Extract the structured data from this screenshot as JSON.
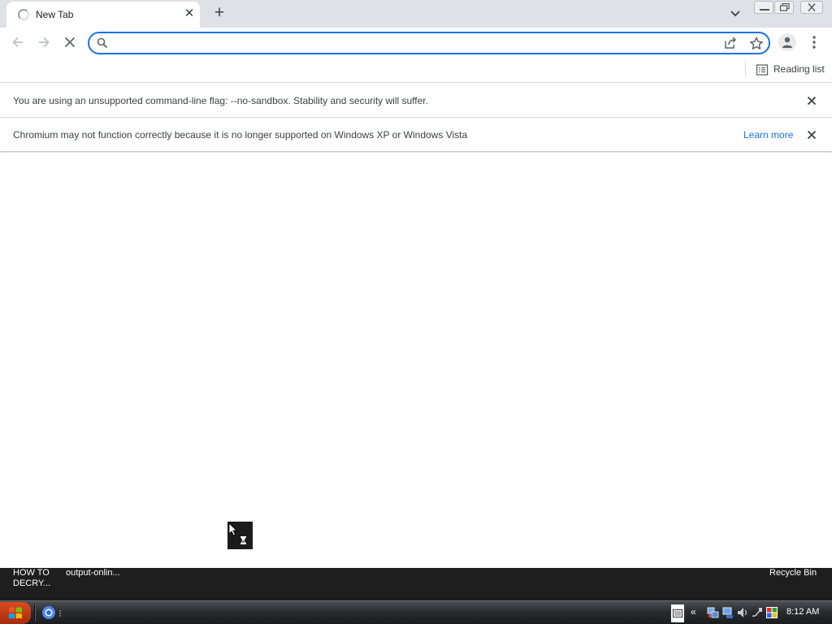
{
  "browser": {
    "tab": {
      "title": "New Tab"
    },
    "omnibox": {
      "value": "",
      "placeholder": ""
    },
    "bookmark_bar": {
      "reading_list_label": "Reading list"
    },
    "infobars": [
      {
        "message": "You are using an unsupported command-line flag: --no-sandbox. Stability and security will suffer."
      },
      {
        "message": "Chromium may not function correctly because it is no longer supported on Windows XP or Windows Vista",
        "link": "Learn more"
      }
    ],
    "colors": {
      "accent": "#1a73e8",
      "tabstrip": "#dee1e6"
    }
  },
  "desktop": {
    "icons": [
      {
        "label_line1": "HOW TO",
        "label_line2": "DECRY..."
      },
      {
        "label_line1": "output-onlin...",
        "label_line2": ""
      },
      {
        "label_line1": "Recycle Bin",
        "label_line2": ""
      }
    ]
  },
  "taskbar": {
    "tray_expand": "«",
    "clock": "8:12 AM"
  }
}
